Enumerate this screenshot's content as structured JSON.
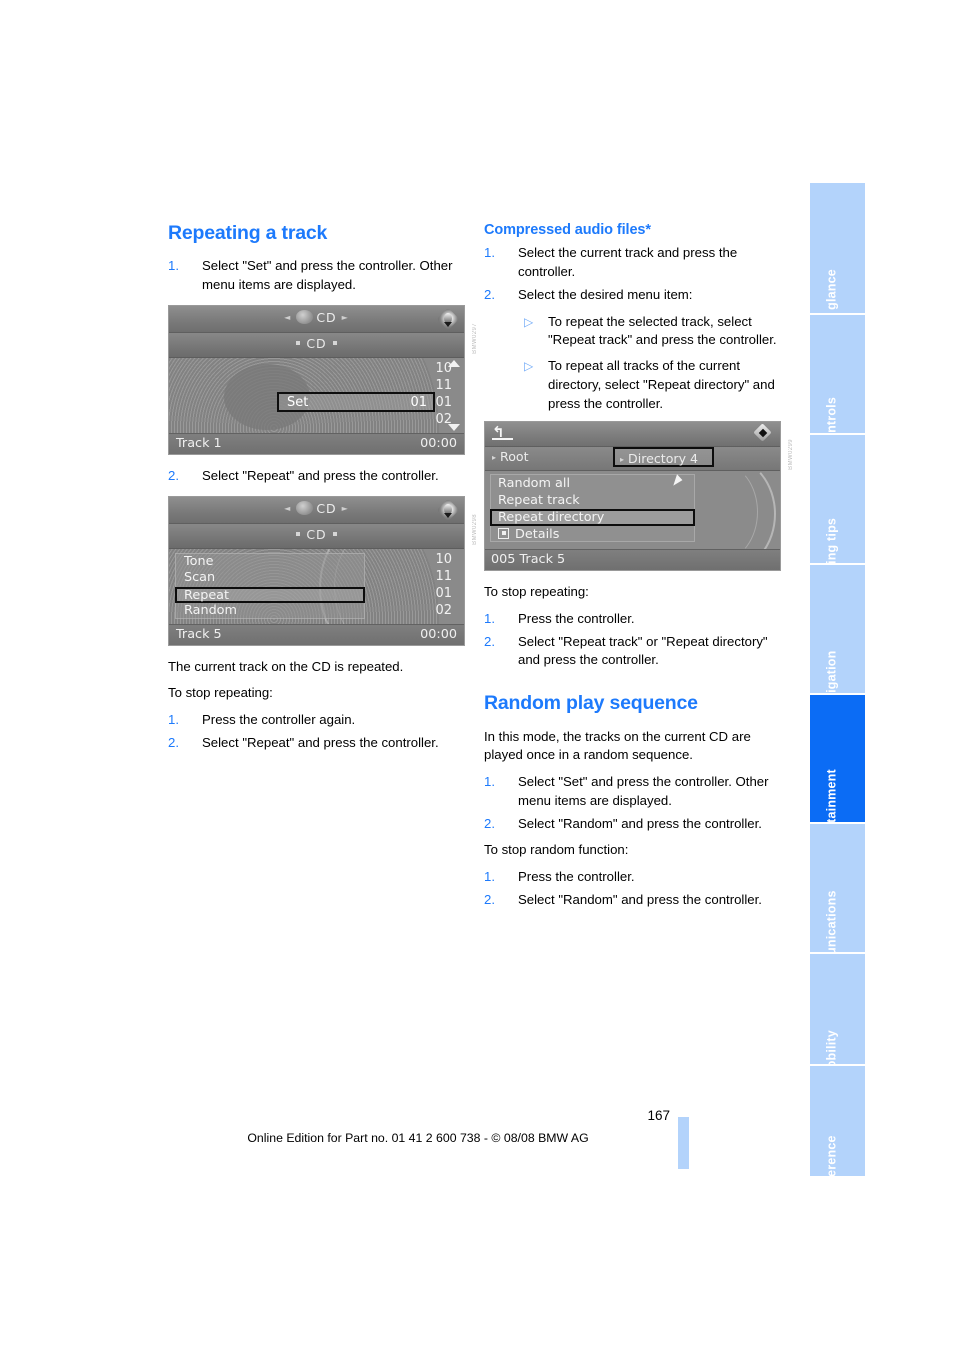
{
  "document": {
    "page_number": "167",
    "edition_line": "Online Edition for Part no. 01 41 2 600 738 - © 08/08 BMW AG"
  },
  "sidebar": {
    "tabs": [
      {
        "label": "At a glance",
        "active": false
      },
      {
        "label": "Controls",
        "active": false
      },
      {
        "label": "Driving tips",
        "active": false
      },
      {
        "label": "Navigation",
        "active": false
      },
      {
        "label": "Entertainment",
        "active": true
      },
      {
        "label": "Communications",
        "active": false
      },
      {
        "label": "Mobility",
        "active": false
      },
      {
        "label": "Reference",
        "active": false
      }
    ],
    "active_color": "#0b6cf5",
    "inactive_color": "#b3d3fb"
  },
  "left_column": {
    "heading": "Repeating a track",
    "step1_num": "1.",
    "step1_text": "Select \"Set\" and press the controller. Other menu items are displayed.",
    "figure1": {
      "caption_code": "BMW0297",
      "top_bar_label": "CD",
      "second_bar_label": "CD",
      "numbers": [
        "10",
        "11",
        "01",
        "02"
      ],
      "selection_label": "Set",
      "selection_value": "01",
      "footer_left": "Track 1",
      "footer_right": "00:00"
    },
    "step2_num": "2.",
    "step2_text": "Select  \"Repeat\" and press the controller.",
    "figure2": {
      "caption_code": "BMW0298",
      "top_bar_label": "CD",
      "second_bar_label": "CD",
      "menu_items": [
        "Tone",
        "Scan",
        "Repeat",
        "Random"
      ],
      "highlighted_item": "Repeat",
      "numbers": [
        "10",
        "11",
        "01",
        "02"
      ],
      "footer_left": "Track 5",
      "footer_right": "00:00"
    },
    "result_text": "The current track on the CD is repeated.",
    "stop_heading": "To stop repeating:",
    "stop_steps": [
      {
        "num": "1.",
        "text": "Press the controller again."
      },
      {
        "num": "2.",
        "text": "Select \"Repeat\" and press the controller."
      }
    ]
  },
  "right_column": {
    "subheading": "Compressed audio files*",
    "steps": [
      {
        "num": "1.",
        "text": "Select the current track and press the controller."
      },
      {
        "num": "2.",
        "text": "Select the desired menu item:"
      }
    ],
    "sub_bullets": [
      {
        "marker": "▷",
        "text": "To repeat the selected track, select \"Repeat track\" and press the controller."
      },
      {
        "marker": "▷",
        "text": "To repeat all tracks of the current directory, select \"Repeat directory\" and press the controller."
      }
    ],
    "figure3": {
      "caption_code": "BMW0299",
      "back_icon": "back-arrow",
      "crumb_root": "Root",
      "crumb_directory": "Directory 4",
      "menu_items": [
        "Random all",
        "Repeat track",
        "Repeat directory",
        "Details"
      ],
      "highlighted_item": "Repeat directory",
      "details_label": "Details",
      "footer_left": "005 Track 5"
    },
    "stop_heading": "To stop repeating:",
    "stop_steps": [
      {
        "num": "1.",
        "text": "Press the controller."
      },
      {
        "num": "2.",
        "text": "Select \"Repeat track\" or \"Repeat directory\" and press the controller."
      }
    ],
    "heading2": "Random play sequence",
    "intro": "In this mode, the tracks on the current CD are played once in a random sequence.",
    "random_steps": [
      {
        "num": "1.",
        "text": "Select \"Set\" and press the controller. Other menu items are displayed."
      },
      {
        "num": "2.",
        "text": "Select \"Random\" and press the controller."
      }
    ],
    "stop_random_heading": "To stop random function:",
    "stop_random_steps": [
      {
        "num": "1.",
        "text": "Press the controller."
      },
      {
        "num": "2.",
        "text": "Select \"Random\" and press the controller."
      }
    ]
  }
}
